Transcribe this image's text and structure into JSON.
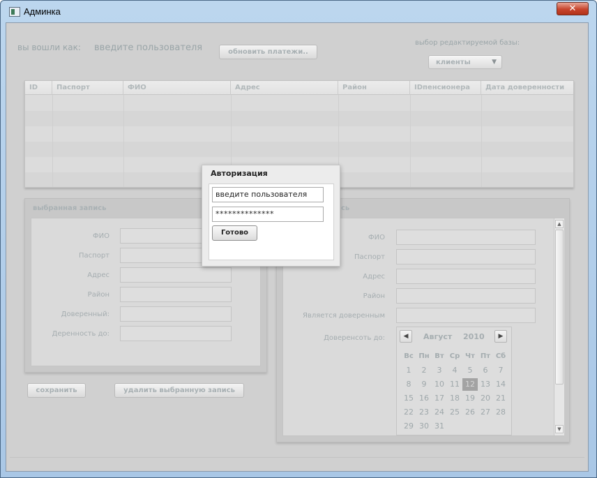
{
  "window": {
    "title": "Админка",
    "close_glyph": "✕",
    "icon": "app-window-icon"
  },
  "header": {
    "logged_in_label": "вы вошли как:",
    "user_placeholder": "введите пользователя",
    "refresh_button": "обновить платежи..",
    "db_select_label": "выбор редактируемой базы:",
    "db_select_value": "клиенты"
  },
  "table": {
    "columns": [
      "ID",
      "Паспорт",
      "ФИО",
      "Адрес",
      "Район",
      "IDпенсионера",
      "Дата доверенности"
    ]
  },
  "left_panel": {
    "title": "выбранная запись",
    "fields": [
      "ФИО",
      "Паспорт",
      "Адрес",
      "Район",
      "Доверенный:",
      "Деренность до:"
    ]
  },
  "right_panel": {
    "title_fragment": "сь",
    "fields": [
      "ФИО",
      "Паспорт",
      "Адрес",
      "Район",
      "Является доверенным",
      "Доверенсоть до:"
    ],
    "calendar": {
      "month": "Август",
      "year": "2010",
      "prev_glyph": "◀",
      "next_glyph": "▶",
      "days_of_week": [
        "Вс",
        "Пн",
        "Вт",
        "Ср",
        "Чт",
        "Пт",
        "Сб"
      ],
      "weeks": [
        [
          "1",
          "2",
          "3",
          "4",
          "5",
          "6",
          "7"
        ],
        [
          "8",
          "9",
          "10",
          "11",
          "12",
          "13",
          "14"
        ],
        [
          "15",
          "16",
          "17",
          "18",
          "19",
          "20",
          "21"
        ],
        [
          "22",
          "23",
          "24",
          "25",
          "26",
          "27",
          "28"
        ],
        [
          "29",
          "30",
          "31",
          "",
          "",
          "",
          ""
        ]
      ],
      "selected": "12"
    }
  },
  "buttons": {
    "save": "сохранить",
    "delete": "удалить выбранную запись"
  },
  "dialog": {
    "title": "Авторизация",
    "user_value": "введите пользователя",
    "password_value": "**************",
    "ok_button": "Готово"
  }
}
